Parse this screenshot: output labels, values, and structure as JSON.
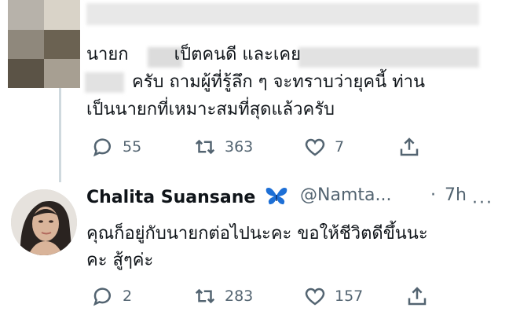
{
  "tweet1": {
    "line1_a": "นายก",
    "line1_b": "เป็ตคนดี และเคย",
    "line2": "ครับ ถามผู้ที่รู้ลึก ๆ จะทราบว่ายุคนี้ ท่าน",
    "line3": "เป็นนายกที่เหมาะสมที่สุดแล้วครับ",
    "reply_count": "55",
    "retweet_count": "363",
    "like_count": "7"
  },
  "tweet2": {
    "display_name": "Chalita Suansane",
    "verified_icon": "butterfly-emoji",
    "handle": "@Namta...",
    "separator": "·",
    "time": "7h",
    "more": "···",
    "line1": "คุณก็อยู่กับนายกต่อไปนะคะ ขอให้ชีวิตดีขึ้นนะ",
    "line2": "คะ สู้ๆค่ะ",
    "reply_count": "2",
    "retweet_count": "283",
    "like_count": "157"
  },
  "colors": {
    "text": "#0f1419",
    "muted": "#536471",
    "accent_butterfly": "#1d6fd6",
    "thread": "#cfd9de"
  }
}
